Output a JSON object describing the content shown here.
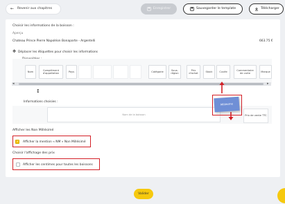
{
  "header": {
    "back_label": "Revenir aux chapitres",
    "save_label": "Enregistrer",
    "template_label": "Sauvegarder le template",
    "download_label": "Télécharger"
  },
  "panel": {
    "choose_info_title": "Choisir les informations de la boisson :",
    "preview_label": "Aperçu",
    "preview_row_name": "Chateau Prince Pierre Napoléon Bonaparte - Argentelli",
    "preview_row_price": "663.75 €",
    "drag_hint": "Déplacer les étiquettes pour choisir les informations",
    "available_label": "Disponibles :",
    "chosen_label": "Informations choisies :",
    "drop_zone_label": "Nom de la boisson",
    "chosen_price_label": "Prix de vente TTC",
    "ghost_card_label": "Millésime",
    "non_vintage_title": "Afficher les Non Millésimé",
    "non_vintage_checkbox_label": "Afficher la mention « NM » Non Millésimé",
    "price_display_title": "Choisir l'affichage des prix",
    "price_cents_checkbox_label": "Afficher les centimes pour toutes les boissons"
  },
  "available_chips": [
    "Nom",
    "Complément d'appellation",
    "Pays",
    "",
    "",
    "",
    "",
    "",
    "Catégorie",
    "Sous-région",
    "Prix d'achat",
    "Stock",
    "Cuvée",
    "Commentaire de carte",
    "Marque"
  ],
  "validate_label": "Valider",
  "colors": {
    "accent_yellow": "#f6c90e",
    "annotation_red": "#d31f26",
    "ghost_card_blue": "#6f8fd6"
  }
}
